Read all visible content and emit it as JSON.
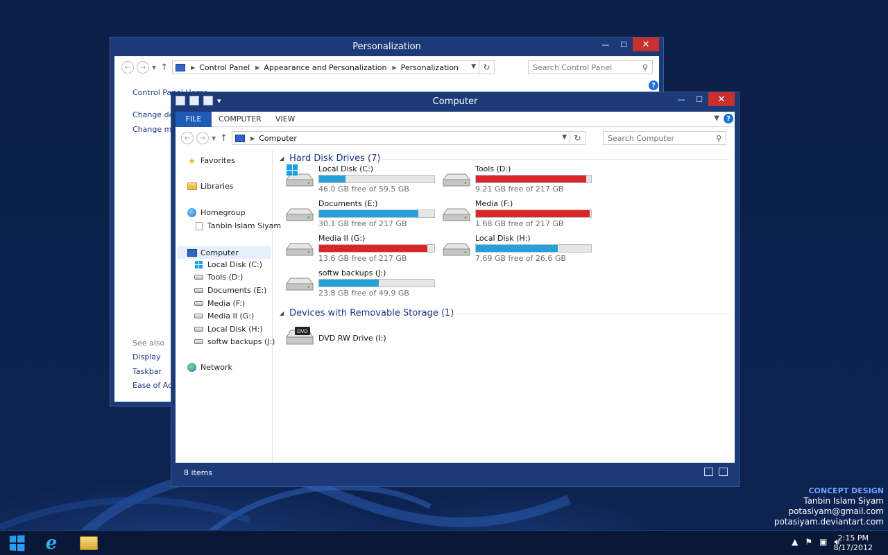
{
  "desktop": {
    "credit": {
      "heading": "CONCEPT DESIGN",
      "lines": [
        "Tanbin Islam Siyam",
        "potasiyam@gmail.com",
        "potasiyam.deviantart.com"
      ]
    }
  },
  "windows": {
    "personalization": {
      "title": "Personalization",
      "caption": {
        "minimize": "—",
        "maximize": "☐",
        "close": "✕"
      },
      "breadcrumbs": [
        "Control Panel",
        "Appearance and Personalization",
        "Personalization"
      ],
      "search_placeholder": "Search Control Panel",
      "links": [
        "Control Panel Home",
        "Change des",
        "Change mo"
      ],
      "see_also_label": "See also",
      "see_also_links": [
        "Display",
        "Taskbar",
        "Ease of Acce"
      ]
    },
    "computer": {
      "title": "Computer",
      "caption": {
        "minimize": "—",
        "maximize": "☐",
        "close": "✕"
      },
      "ribbon_tabs": [
        "FILE",
        "COMPUTER",
        "VIEW"
      ],
      "breadcrumbs": [
        "Computer"
      ],
      "search_placeholder": "Search Computer",
      "nav": {
        "favorites": "Favorites",
        "libraries": "Libraries",
        "homegroup": "Homegroup",
        "homegroup_user": "Tanbin Islam Siyam",
        "computer": "Computer",
        "drives": [
          "Local Disk (C:)",
          "Tools (D:)",
          "Documents (E:)",
          "Media (F:)",
          "Media II (G:)",
          "Local Disk (H:)",
          "softw backups (J:)"
        ],
        "network": "Network"
      },
      "groups": {
        "hdd_title": "Hard Disk Drives (7)",
        "removable_title": "Devices with Removable Storage (1)"
      },
      "drives": [
        {
          "name": "Local Disk (C:)",
          "free": "46.0 GB free of 59.5 GB",
          "used_fraction": 0.23,
          "color": "#26a0da",
          "system": true
        },
        {
          "name": "Tools (D:)",
          "free": "9.21 GB free of 217 GB",
          "used_fraction": 0.96,
          "color": "#da2626"
        },
        {
          "name": "Documents (E:)",
          "free": "30.1 GB free of 217 GB",
          "used_fraction": 0.86,
          "color": "#26a0da"
        },
        {
          "name": "Media (F:)",
          "free": "1.68 GB free of 217 GB",
          "used_fraction": 0.99,
          "color": "#da2626"
        },
        {
          "name": "Media II (G:)",
          "free": "13.6 GB free of 217 GB",
          "used_fraction": 0.94,
          "color": "#da2626"
        },
        {
          "name": "Local Disk (H:)",
          "free": "7.69 GB free of 26.6 GB",
          "used_fraction": 0.71,
          "color": "#26a0da"
        },
        {
          "name": "softw backups (J:)",
          "free": "23.8 GB free of 49.9 GB",
          "used_fraction": 0.52,
          "color": "#26a0da"
        }
      ],
      "removable": [
        {
          "name": "DVD RW Drive (I:)",
          "badge": "DVD"
        }
      ],
      "status": "8 items"
    }
  },
  "taskbar": {
    "clock_time": "2:15 PM",
    "clock_date": "8/17/2012"
  }
}
